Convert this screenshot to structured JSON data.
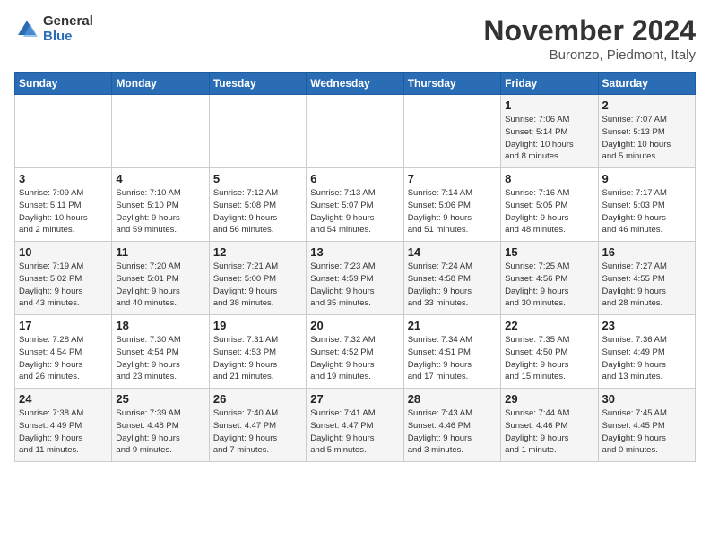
{
  "logo": {
    "general": "General",
    "blue": "Blue"
  },
  "header": {
    "title": "November 2024",
    "location": "Buronzo, Piedmont, Italy"
  },
  "weekdays": [
    "Sunday",
    "Monday",
    "Tuesday",
    "Wednesday",
    "Thursday",
    "Friday",
    "Saturday"
  ],
  "weeks": [
    [
      {
        "day": "",
        "info": ""
      },
      {
        "day": "",
        "info": ""
      },
      {
        "day": "",
        "info": ""
      },
      {
        "day": "",
        "info": ""
      },
      {
        "day": "",
        "info": ""
      },
      {
        "day": "1",
        "info": "Sunrise: 7:06 AM\nSunset: 5:14 PM\nDaylight: 10 hours\nand 8 minutes."
      },
      {
        "day": "2",
        "info": "Sunrise: 7:07 AM\nSunset: 5:13 PM\nDaylight: 10 hours\nand 5 minutes."
      }
    ],
    [
      {
        "day": "3",
        "info": "Sunrise: 7:09 AM\nSunset: 5:11 PM\nDaylight: 10 hours\nand 2 minutes."
      },
      {
        "day": "4",
        "info": "Sunrise: 7:10 AM\nSunset: 5:10 PM\nDaylight: 9 hours\nand 59 minutes."
      },
      {
        "day": "5",
        "info": "Sunrise: 7:12 AM\nSunset: 5:08 PM\nDaylight: 9 hours\nand 56 minutes."
      },
      {
        "day": "6",
        "info": "Sunrise: 7:13 AM\nSunset: 5:07 PM\nDaylight: 9 hours\nand 54 minutes."
      },
      {
        "day": "7",
        "info": "Sunrise: 7:14 AM\nSunset: 5:06 PM\nDaylight: 9 hours\nand 51 minutes."
      },
      {
        "day": "8",
        "info": "Sunrise: 7:16 AM\nSunset: 5:05 PM\nDaylight: 9 hours\nand 48 minutes."
      },
      {
        "day": "9",
        "info": "Sunrise: 7:17 AM\nSunset: 5:03 PM\nDaylight: 9 hours\nand 46 minutes."
      }
    ],
    [
      {
        "day": "10",
        "info": "Sunrise: 7:19 AM\nSunset: 5:02 PM\nDaylight: 9 hours\nand 43 minutes."
      },
      {
        "day": "11",
        "info": "Sunrise: 7:20 AM\nSunset: 5:01 PM\nDaylight: 9 hours\nand 40 minutes."
      },
      {
        "day": "12",
        "info": "Sunrise: 7:21 AM\nSunset: 5:00 PM\nDaylight: 9 hours\nand 38 minutes."
      },
      {
        "day": "13",
        "info": "Sunrise: 7:23 AM\nSunset: 4:59 PM\nDaylight: 9 hours\nand 35 minutes."
      },
      {
        "day": "14",
        "info": "Sunrise: 7:24 AM\nSunset: 4:58 PM\nDaylight: 9 hours\nand 33 minutes."
      },
      {
        "day": "15",
        "info": "Sunrise: 7:25 AM\nSunset: 4:56 PM\nDaylight: 9 hours\nand 30 minutes."
      },
      {
        "day": "16",
        "info": "Sunrise: 7:27 AM\nSunset: 4:55 PM\nDaylight: 9 hours\nand 28 minutes."
      }
    ],
    [
      {
        "day": "17",
        "info": "Sunrise: 7:28 AM\nSunset: 4:54 PM\nDaylight: 9 hours\nand 26 minutes."
      },
      {
        "day": "18",
        "info": "Sunrise: 7:30 AM\nSunset: 4:54 PM\nDaylight: 9 hours\nand 23 minutes."
      },
      {
        "day": "19",
        "info": "Sunrise: 7:31 AM\nSunset: 4:53 PM\nDaylight: 9 hours\nand 21 minutes."
      },
      {
        "day": "20",
        "info": "Sunrise: 7:32 AM\nSunset: 4:52 PM\nDaylight: 9 hours\nand 19 minutes."
      },
      {
        "day": "21",
        "info": "Sunrise: 7:34 AM\nSunset: 4:51 PM\nDaylight: 9 hours\nand 17 minutes."
      },
      {
        "day": "22",
        "info": "Sunrise: 7:35 AM\nSunset: 4:50 PM\nDaylight: 9 hours\nand 15 minutes."
      },
      {
        "day": "23",
        "info": "Sunrise: 7:36 AM\nSunset: 4:49 PM\nDaylight: 9 hours\nand 13 minutes."
      }
    ],
    [
      {
        "day": "24",
        "info": "Sunrise: 7:38 AM\nSunset: 4:49 PM\nDaylight: 9 hours\nand 11 minutes."
      },
      {
        "day": "25",
        "info": "Sunrise: 7:39 AM\nSunset: 4:48 PM\nDaylight: 9 hours\nand 9 minutes."
      },
      {
        "day": "26",
        "info": "Sunrise: 7:40 AM\nSunset: 4:47 PM\nDaylight: 9 hours\nand 7 minutes."
      },
      {
        "day": "27",
        "info": "Sunrise: 7:41 AM\nSunset: 4:47 PM\nDaylight: 9 hours\nand 5 minutes."
      },
      {
        "day": "28",
        "info": "Sunrise: 7:43 AM\nSunset: 4:46 PM\nDaylight: 9 hours\nand 3 minutes."
      },
      {
        "day": "29",
        "info": "Sunrise: 7:44 AM\nSunset: 4:46 PM\nDaylight: 9 hours\nand 1 minute."
      },
      {
        "day": "30",
        "info": "Sunrise: 7:45 AM\nSunset: 4:45 PM\nDaylight: 9 hours\nand 0 minutes."
      }
    ]
  ]
}
